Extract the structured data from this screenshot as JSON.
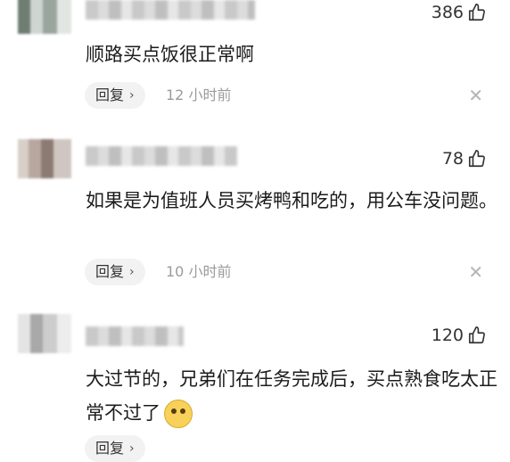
{
  "comments": [
    {
      "likes": "386",
      "text": "顺路买点饭很正常啊",
      "reply_label": "回复",
      "time": "12 小时前"
    },
    {
      "likes": "78",
      "text": "如果是为值班人员买烤鸭和吃的，用公车没问题。",
      "reply_label": "回复",
      "time": "10 小时前"
    },
    {
      "likes": "120",
      "text": "大过节的，兄弟们在任务完成后，买点熟食吃太正常不过了",
      "reply_label": "回复",
      "time": ""
    }
  ],
  "icons": {
    "like": "thumbs-up-icon",
    "close": "close-icon",
    "chevron": "chevron-right-icon",
    "emoji": "smirk-emoji-icon"
  },
  "colors": {
    "text": "#1c1c1c",
    "muted": "#9b9b9b",
    "reply_bg": "#f2f2f2"
  }
}
